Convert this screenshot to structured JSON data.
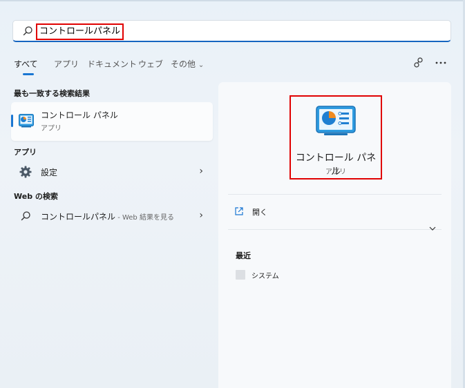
{
  "search": {
    "query": "コントロールパネル"
  },
  "tabs": [
    {
      "label": "すべて"
    },
    {
      "label": "アプリ"
    },
    {
      "label": "ドキュメント"
    },
    {
      "label": "ウェブ"
    },
    {
      "label": "その他"
    }
  ],
  "best_match": {
    "section_label": "最も一致する検索結果",
    "title": "コントロール パネル",
    "subtitle": "アプリ"
  },
  "apps": {
    "section_label": "アプリ",
    "items": [
      {
        "label": "設定"
      }
    ]
  },
  "web": {
    "section_label": "Web の検索",
    "query": "コントロールパネル",
    "suffix": " - Web 結果を見る"
  },
  "detail": {
    "title": "コントロール パネル",
    "subtitle": "アプリ",
    "open_label": "開く",
    "recent_label": "最近",
    "recent_items": [
      {
        "label": "システム"
      }
    ]
  },
  "colors": {
    "accent": "#1976d2",
    "highlight_box": "#e00000"
  },
  "icons": [
    "search-icon",
    "share-icon",
    "more-icon",
    "control-panel-icon",
    "gear-icon",
    "open-external-icon",
    "chevron-down-icon",
    "chevron-right-icon"
  ]
}
